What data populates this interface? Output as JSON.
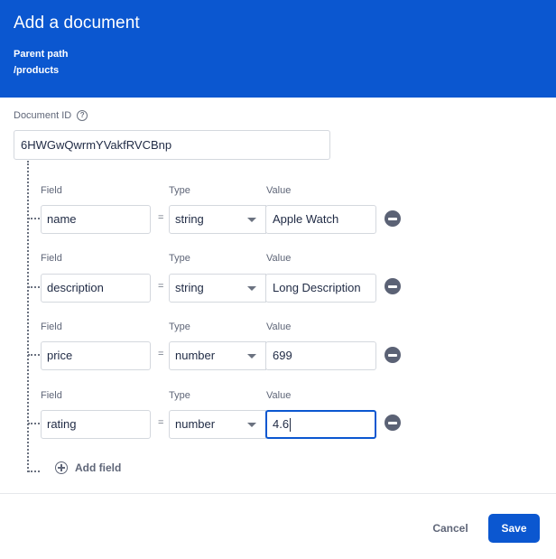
{
  "header": {
    "title": "Add a document",
    "parent_path_label": "Parent path",
    "parent_path_value": "/products"
  },
  "document_id": {
    "label": "Document ID",
    "help_icon": "help-circle-icon",
    "value": "6HWGwQwrmYVakfRVCBnp"
  },
  "field_labels": {
    "field": "Field",
    "type": "Type",
    "value": "Value",
    "equals": "="
  },
  "fields": [
    {
      "name": "name",
      "type": "string",
      "value": "Apple Watch",
      "focused": false
    },
    {
      "name": "description",
      "type": "string",
      "value": "Long Description",
      "focused": false
    },
    {
      "name": "price",
      "type": "number",
      "value": "699",
      "focused": false
    },
    {
      "name": "rating",
      "type": "number",
      "value": "4.6",
      "focused": true
    }
  ],
  "add_field": {
    "label": "Add field",
    "icon": "plus-circle-icon"
  },
  "footer": {
    "cancel_label": "Cancel",
    "save_label": "Save"
  },
  "colors": {
    "primary": "#0b57d0",
    "remove_icon": "#5b6275"
  }
}
